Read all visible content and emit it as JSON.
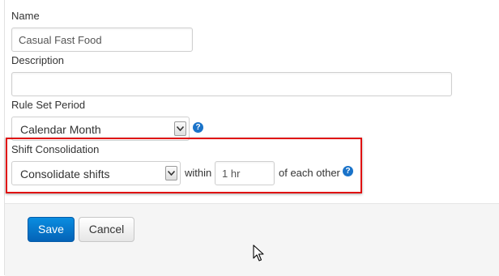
{
  "form": {
    "name": {
      "label": "Name",
      "value": "Casual Fast Food"
    },
    "description": {
      "label": "Description",
      "value": ""
    },
    "rule_set_period": {
      "label": "Rule Set Period",
      "selected": "Calendar Month"
    },
    "shift_consolidation": {
      "label": "Shift Consolidation",
      "selected": "Consolidate shifts",
      "within_label": "within",
      "within_value": "1 hr",
      "suffix_label": "of each other"
    },
    "help_glyph": "?"
  },
  "actions": {
    "save_label": "Save",
    "cancel_label": "Cancel"
  },
  "colors": {
    "primary_button": "#0a7bd4",
    "highlight_border": "#e01010",
    "help_icon": "#1a73c9"
  },
  "icons": [
    "help-icon",
    "chevron-down-icon",
    "mouse-cursor-icon"
  ]
}
